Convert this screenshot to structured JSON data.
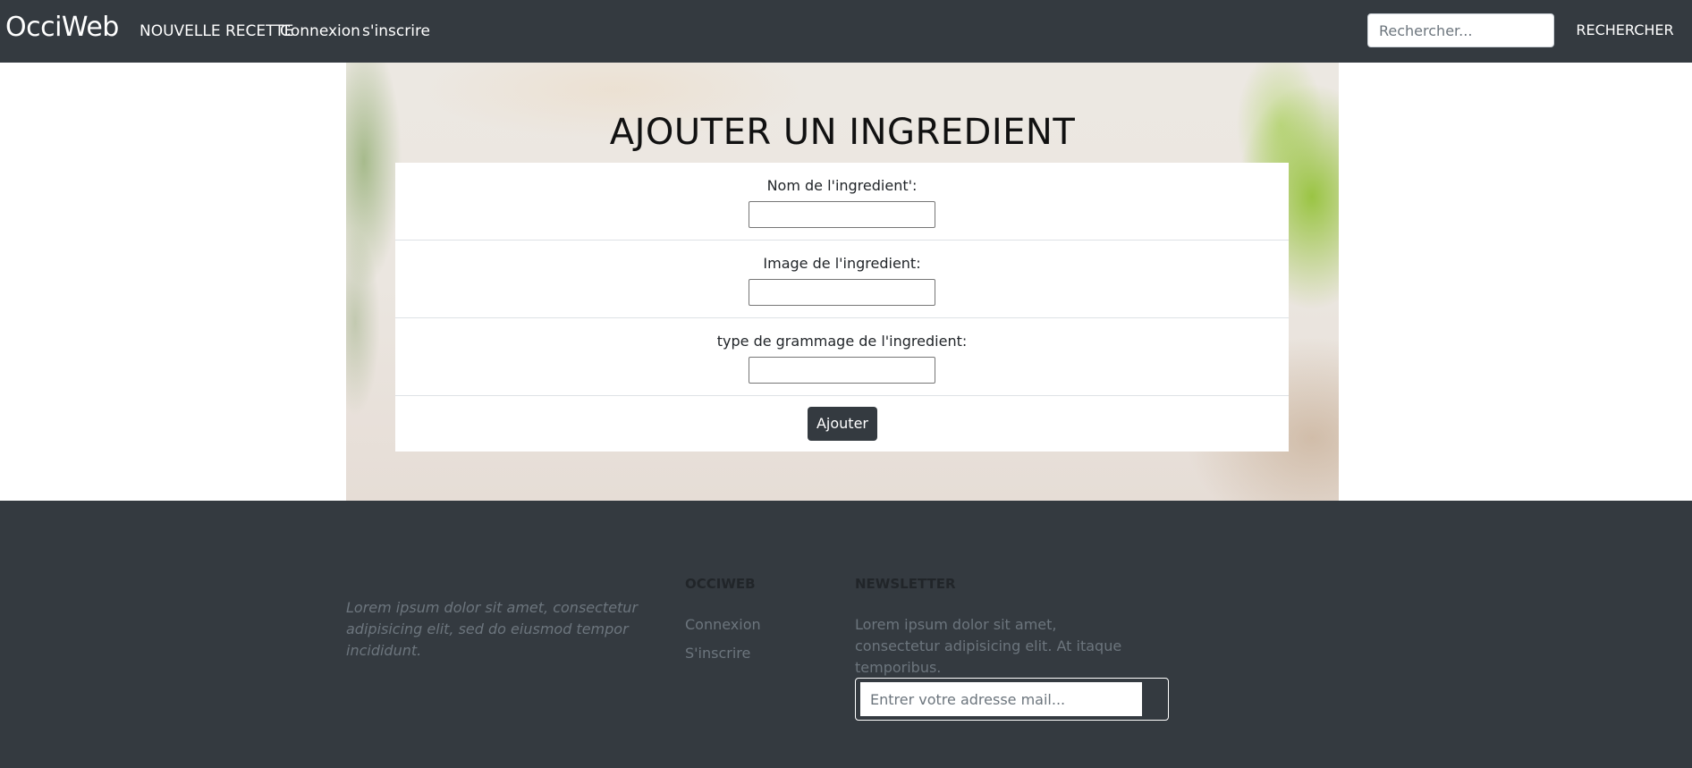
{
  "navbar": {
    "brand": "OcciWeb",
    "links": {
      "new_recipe": "NOUVELLE RECETTE",
      "login": "Connexion",
      "signup": "s'inscrire"
    },
    "search": {
      "placeholder": "Rechercher...",
      "button_label": "RECHERCHER"
    }
  },
  "hero": {
    "title": "AJOUTER UN INGREDIENT",
    "form": {
      "fields": [
        {
          "label": "Nom de l'ingredient':",
          "value": ""
        },
        {
          "label": "Image de l'ingredient:",
          "value": ""
        },
        {
          "label": "type de grammage de l'ingredient:",
          "value": ""
        }
      ],
      "submit_label": "Ajouter"
    }
  },
  "footer": {
    "about": "Lorem ipsum dolor sit amet, consectetur adipisicing elit, sed do eiusmod tempor incididunt.",
    "occiweb": {
      "heading": "OCCIWEB",
      "links": [
        "Connexion",
        "S'inscrire"
      ]
    },
    "newsletter": {
      "heading": "NEWSLETTER",
      "text": "Lorem ipsum dolor sit amet, consectetur adipisicing elit. At itaque temporibus.",
      "placeholder": "Entrer votre adresse mail..."
    }
  },
  "colors": {
    "dark": "#343a40",
    "muted": "#6c757d",
    "white": "#ffffff"
  }
}
